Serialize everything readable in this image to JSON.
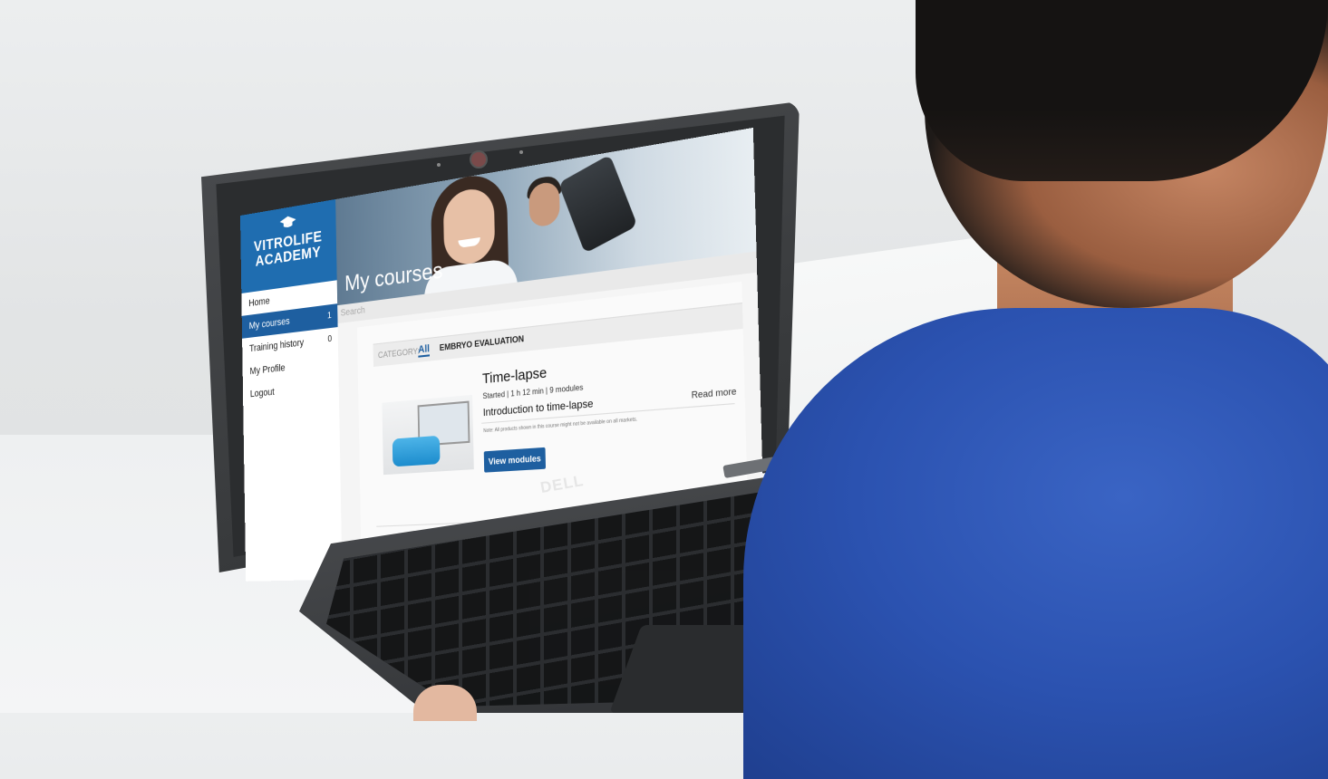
{
  "scene": {
    "description_labels": {
      "laptop_brand": "DELL"
    }
  },
  "app": {
    "brand": {
      "line1": "VITROLIFE",
      "line2": "ACADEMY"
    },
    "nav": [
      {
        "label": "Home",
        "count": "",
        "active": false
      },
      {
        "label": "My courses",
        "count": "1",
        "active": true
      },
      {
        "label": "Training history",
        "count": "0",
        "active": false
      },
      {
        "label": "My Profile",
        "count": "",
        "active": false
      },
      {
        "label": "Logout",
        "count": "",
        "active": false
      }
    ],
    "hero_title": "My courses",
    "search_placeholder": "Search",
    "category": {
      "label": "CATEGORY:",
      "all": "All",
      "embryo": "EMBRYO EVALUATION"
    },
    "course": {
      "title": "Time-lapse",
      "meta": "Started | 1 h 12 min | 9 modules",
      "subtitle": "Introduction to time-lapse",
      "note": "Note: All products shown in this course might not be available on all markets.",
      "read_more": "Read more",
      "button": "View modules"
    }
  },
  "colors": {
    "brand_blue": "#1f6db0",
    "active_nav": "#1e5fa0",
    "shirt": "#2b52b0"
  }
}
